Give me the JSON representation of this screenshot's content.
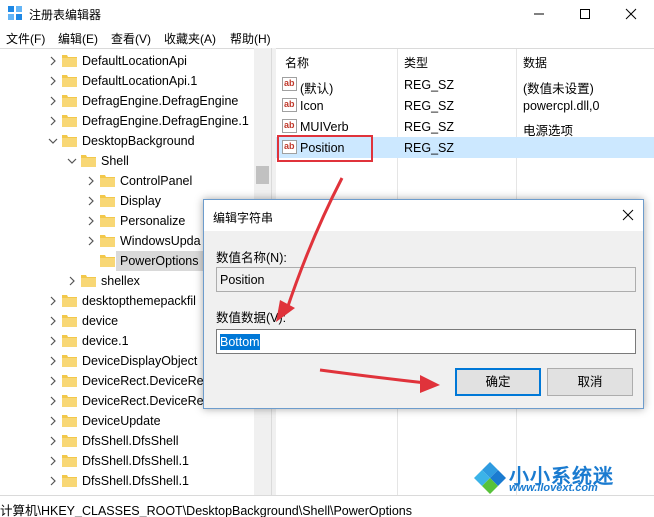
{
  "window": {
    "title": "注册表编辑器"
  },
  "menu": [
    "文件(F)",
    "编辑(E)",
    "查看(V)",
    "收藏夹(A)",
    "帮助(H)"
  ],
  "tree": [
    {
      "label": "DefaultLocationApi",
      "level": 0,
      "expander": "right"
    },
    {
      "label": "DefaultLocationApi.1",
      "level": 0,
      "expander": "right"
    },
    {
      "label": "DefragEngine.DefragEngine",
      "level": 0,
      "expander": "right"
    },
    {
      "label": "DefragEngine.DefragEngine.1",
      "level": 0,
      "expander": "right"
    },
    {
      "label": "DesktopBackground",
      "level": 0,
      "expander": "down"
    },
    {
      "label": "Shell",
      "level": 1,
      "expander": "down"
    },
    {
      "label": "ControlPanel",
      "level": 2,
      "expander": "right"
    },
    {
      "label": "Display",
      "level": 2,
      "expander": "right"
    },
    {
      "label": "Personalize",
      "level": 2,
      "expander": "right"
    },
    {
      "label": "WindowsUpda",
      "level": 2,
      "expander": "right"
    },
    {
      "label": "PowerOptions",
      "level": 2,
      "expander": "none",
      "selected": true
    },
    {
      "label": "shellex",
      "level": 1,
      "expander": "right"
    },
    {
      "label": "desktopthemepackfil",
      "level": 0,
      "expander": "right"
    },
    {
      "label": "device",
      "level": 0,
      "expander": "right"
    },
    {
      "label": "device.1",
      "level": 0,
      "expander": "right"
    },
    {
      "label": "DeviceDisplayObject",
      "level": 0,
      "expander": "right"
    },
    {
      "label": "DeviceRect.DeviceRe",
      "level": 0,
      "expander": "right"
    },
    {
      "label": "DeviceRect.DeviceRe",
      "level": 0,
      "expander": "right"
    },
    {
      "label": "DeviceUpdate",
      "level": 0,
      "expander": "right"
    },
    {
      "label": "DfsShell.DfsShell",
      "level": 0,
      "expander": "right"
    },
    {
      "label": "DfsShell.DfsShell.1",
      "level": 0,
      "expander": "right"
    },
    {
      "label": "DfsShell.DfsShell.1",
      "level": 0,
      "expander": "right"
    }
  ],
  "columns": {
    "name": "名称",
    "type": "类型",
    "data": "数据"
  },
  "values": [
    {
      "name": "(默认)",
      "type": "REG_SZ",
      "data": "(数值未设置)"
    },
    {
      "name": "Icon",
      "type": "REG_SZ",
      "data": "powercpl.dll,0"
    },
    {
      "name": "MUIVerb",
      "type": "REG_SZ",
      "data": "电源选项"
    },
    {
      "name": "Position",
      "type": "REG_SZ",
      "data": ""
    }
  ],
  "status": {
    "path": "计算机\\HKEY_CLASSES_ROOT\\DesktopBackground\\Shell\\PowerOptions"
  },
  "dialog": {
    "title": "编辑字符串",
    "name_label": "数值名称(N):",
    "name_value": "Position",
    "data_label": "数值数据(V):",
    "data_value": "Bottom",
    "ok_label": "确定",
    "cancel_label": "取消"
  },
  "watermark": {
    "title": "小小系统迷",
    "url": "www.ilovext.com"
  },
  "colors": {
    "highlight_row": "#cce8ff",
    "annotation_red": "#e0333b",
    "selection_blue": "#0078d7",
    "folder": "#f2c84b"
  }
}
